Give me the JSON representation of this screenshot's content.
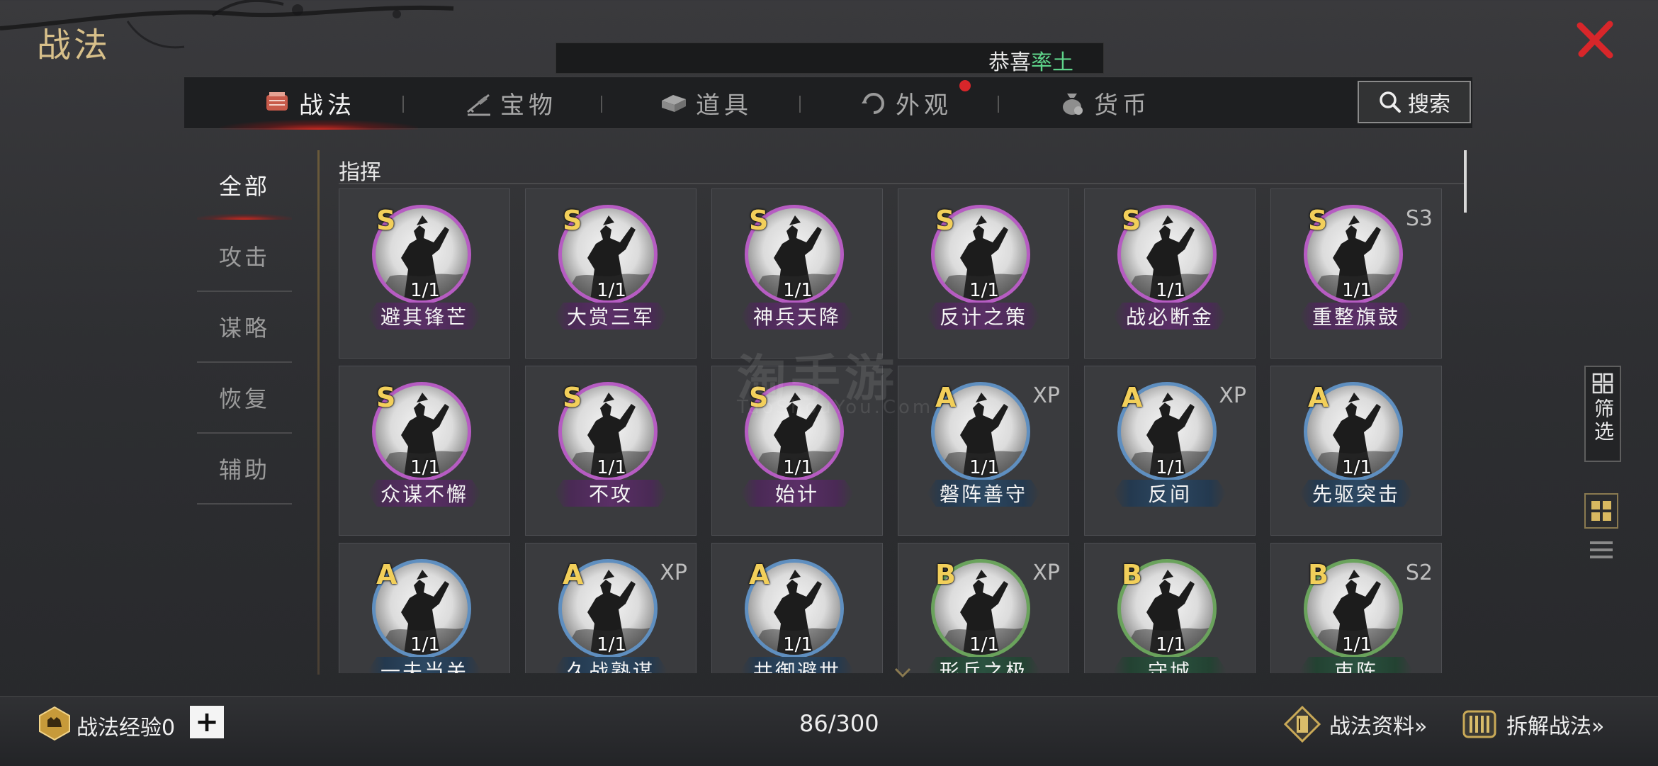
{
  "page": {
    "title": "战法"
  },
  "marquee": {
    "prefix": "恭喜",
    "highlight": "率土"
  },
  "tabs": [
    {
      "label": "战法",
      "icon": "scroll-icon",
      "active": true
    },
    {
      "label": "宝物",
      "icon": "treasure-icon",
      "active": false
    },
    {
      "label": "道具",
      "icon": "item-box-icon",
      "active": false
    },
    {
      "label": "外观",
      "icon": "appearance-icon",
      "active": false,
      "badge": true
    },
    {
      "label": "货币",
      "icon": "money-bag-icon",
      "active": false
    }
  ],
  "search": {
    "label": "搜索"
  },
  "categories": [
    {
      "label": "全部",
      "active": true
    },
    {
      "label": "攻击"
    },
    {
      "label": "谋略"
    },
    {
      "label": "恢复"
    },
    {
      "label": "辅助"
    }
  ],
  "section": {
    "title": "指挥"
  },
  "watermark": {
    "main": "淘手游",
    "sub": "TaoShouYou.Com"
  },
  "cards": [
    {
      "grade": "S",
      "count": "1/1",
      "name": "避其锋芒",
      "tag": "",
      "tier": "purple"
    },
    {
      "grade": "S",
      "count": "1/1",
      "name": "大赏三军",
      "tag": "",
      "tier": "purple"
    },
    {
      "grade": "S",
      "count": "1/1",
      "name": "神兵天降",
      "tag": "",
      "tier": "purple"
    },
    {
      "grade": "S",
      "count": "1/1",
      "name": "反计之策",
      "tag": "",
      "tier": "purple"
    },
    {
      "grade": "S",
      "count": "1/1",
      "name": "战必断金",
      "tag": "",
      "tier": "purple"
    },
    {
      "grade": "S",
      "count": "1/1",
      "name": "重整旗鼓",
      "tag": "S3",
      "tier": "purple"
    },
    {
      "grade": "S",
      "count": "1/1",
      "name": "众谋不懈",
      "tag": "",
      "tier": "purple"
    },
    {
      "grade": "S",
      "count": "1/1",
      "name": "不攻",
      "tag": "",
      "tier": "purple"
    },
    {
      "grade": "S",
      "count": "1/1",
      "name": "始计",
      "tag": "",
      "tier": "purple"
    },
    {
      "grade": "A",
      "count": "1/1",
      "name": "磐阵善守",
      "tag": "XP",
      "tier": "blue"
    },
    {
      "grade": "A",
      "count": "1/1",
      "name": "反间",
      "tag": "XP",
      "tier": "blue"
    },
    {
      "grade": "A",
      "count": "1/1",
      "name": "先驱突击",
      "tag": "",
      "tier": "blue"
    },
    {
      "grade": "A",
      "count": "1/1",
      "name": "一夫当关",
      "tag": "",
      "tier": "blue"
    },
    {
      "grade": "A",
      "count": "1/1",
      "name": "久战熟谋",
      "tag": "XP",
      "tier": "blue"
    },
    {
      "grade": "A",
      "count": "1/1",
      "name": "共御避世",
      "tag": "",
      "tier": "blue"
    },
    {
      "grade": "B",
      "count": "1/1",
      "name": "形兵之极",
      "tag": "XP",
      "tier": "green"
    },
    {
      "grade": "B",
      "count": "1/1",
      "name": "守城",
      "tag": "",
      "tier": "green"
    },
    {
      "grade": "B",
      "count": "1/1",
      "name": "束阵",
      "tag": "S2",
      "tier": "green"
    }
  ],
  "filter": {
    "label": "筛选"
  },
  "bottom": {
    "exp_label": "战法经验0",
    "plus": "+",
    "capacity": "86/300",
    "info_label": "战法资料»",
    "disassemble_label": "拆解战法»"
  },
  "colors": {
    "accent_red": "#d8262a",
    "grade_gold": "#f2cf5a",
    "title_gold": "#d8c08a",
    "marquee_green": "#5fd48a"
  }
}
